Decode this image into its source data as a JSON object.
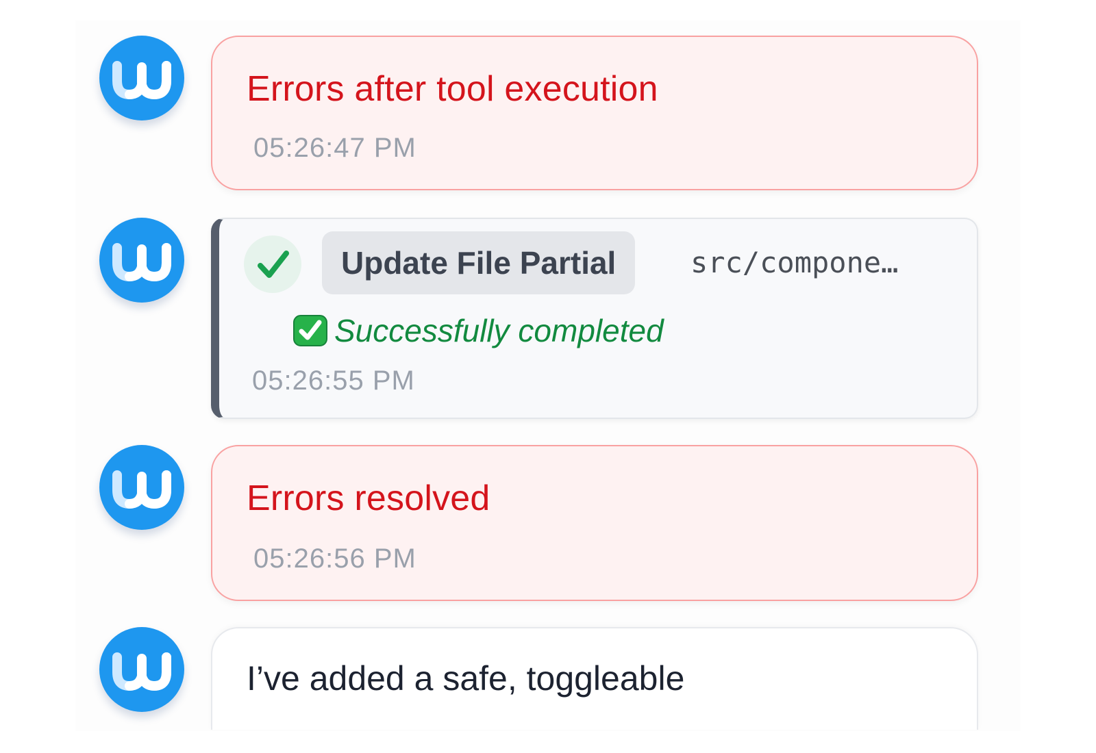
{
  "messages": [
    {
      "kind": "error",
      "avatar_icon": "w-logo-icon",
      "text": "Errors after tool execution",
      "time": "05:26:47 PM"
    },
    {
      "kind": "tool",
      "avatar_icon": "w-logo-icon",
      "status_icon": "checkmark-icon",
      "tool_name": "Update File Partial",
      "path": "src/compone…",
      "status_emoji": "white-check-mark-emoji-icon",
      "status_text": "Successfully completed",
      "time": "05:26:55 PM"
    },
    {
      "kind": "error",
      "avatar_icon": "w-logo-icon",
      "text": "Errors resolved",
      "time": "05:26:56 PM"
    },
    {
      "kind": "message",
      "avatar_icon": "w-logo-icon",
      "text": "I’ve added a safe, toggleable"
    }
  ],
  "colors": {
    "avatar": "#1e97ef",
    "error_text": "#d4141c",
    "error_bg": "#fef2f2",
    "error_border": "#f9a1a1",
    "success_text": "#128a3f",
    "tool_accent": "#565e6c",
    "timestamp": "#99a0ab"
  }
}
